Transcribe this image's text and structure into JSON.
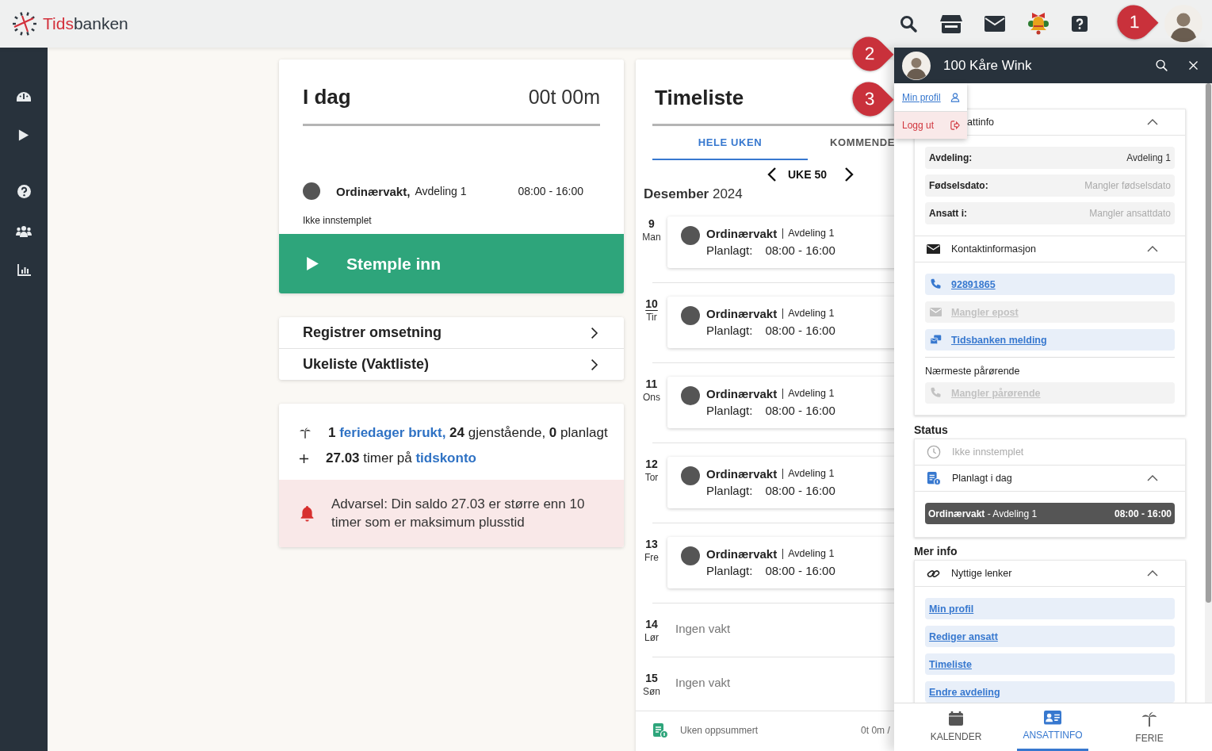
{
  "logo": {
    "accent": "Tids",
    "rest": "banken"
  },
  "callouts": [
    {
      "label": "1"
    },
    {
      "label": "2"
    },
    {
      "label": "3"
    }
  ],
  "today": {
    "title": "I dag",
    "total": "00t 00m",
    "shift": {
      "name": "Ordinærvakt,",
      "department": "Avdeling 1",
      "time": "08:00 - 16:00"
    },
    "status": "Ikke innstemplet",
    "clock_in_button": "Stemple inn"
  },
  "quick_links": [
    {
      "label": "Registrer omsetning"
    },
    {
      "label": "Ukeliste (Vaktliste)"
    }
  ],
  "balance": {
    "vacation": [
      {
        "text": "1",
        "kind": "value"
      },
      {
        "text": "feriedager brukt,",
        "kind": "link"
      },
      {
        "text": "24",
        "kind": "value"
      },
      {
        "text": "gjenstående,",
        "kind": "plain"
      },
      {
        "text": "0",
        "kind": "value"
      },
      {
        "text": "planlagt",
        "kind": "plain"
      }
    ],
    "flex": [
      {
        "text": "27.03",
        "kind": "value"
      },
      {
        "text": "timer på",
        "kind": "plain"
      },
      {
        "text": "tidskonto",
        "kind": "link"
      }
    ],
    "warning": "Advarsel: Din saldo 27.03 er større enn 10 timer som er maksimum plusstid"
  },
  "timesheet": {
    "title": "Timeliste",
    "tabs": [
      {
        "label": "HELE UKEN",
        "selected": true
      },
      {
        "label": "KOMMENDE",
        "selected": false
      }
    ],
    "week": "UKE 50",
    "month": "Desember",
    "year": "2024",
    "days": [
      {
        "date": "9",
        "weekday": "Man",
        "today": false,
        "kind": "shift",
        "name": "Ordinærvakt",
        "department": "Avdeling 1",
        "planned_label": "Planlagt:",
        "time": "08:00 - 16:00"
      },
      {
        "date": "10",
        "weekday": "Tir",
        "today": true,
        "kind": "shift",
        "name": "Ordinærvakt",
        "department": "Avdeling 1",
        "planned_label": "Planlagt:",
        "time": "08:00 - 16:00"
      },
      {
        "date": "11",
        "weekday": "Ons",
        "today": false,
        "kind": "shift",
        "name": "Ordinærvakt",
        "department": "Avdeling 1",
        "planned_label": "Planlagt:",
        "time": "08:00 - 16:00"
      },
      {
        "date": "12",
        "weekday": "Tor",
        "today": false,
        "kind": "shift",
        "name": "Ordinærvakt",
        "department": "Avdeling 1",
        "planned_label": "Planlagt:",
        "time": "08:00 - 16:00"
      },
      {
        "date": "13",
        "weekday": "Fre",
        "today": false,
        "kind": "shift",
        "name": "Ordinærvakt",
        "department": "Avdeling 1",
        "planned_label": "Planlagt:",
        "time": "08:00 - 16:00"
      },
      {
        "date": "14",
        "weekday": "Lør",
        "today": false,
        "kind": "empty",
        "text": "Ingen vakt"
      },
      {
        "date": "15",
        "weekday": "Søn",
        "today": false,
        "kind": "empty",
        "text": "Ingen vakt"
      }
    ],
    "summary": {
      "label": "Uken oppsummert",
      "value": "0t 0m /"
    }
  },
  "panel": {
    "name": "100 Kåre Wink",
    "menu": [
      {
        "label": "Min profil",
        "kind": "profile"
      },
      {
        "label": "Logg ut",
        "kind": "logout"
      }
    ],
    "employee_info": {
      "title": "attinfo",
      "expanded": true,
      "fields": [
        {
          "label": "Avdeling:",
          "value": "Avdeling 1",
          "missing": false
        },
        {
          "label": "Fødselsdato:",
          "value": "Mangler fødselsdato",
          "missing": true
        },
        {
          "label": "Ansatt i:",
          "value": "Mangler ansattdato",
          "missing": true
        }
      ]
    },
    "contact": {
      "title": "Kontaktinformasjon",
      "expanded": true,
      "items": [
        {
          "kind": "phone",
          "text": "92891865",
          "missing": false
        },
        {
          "kind": "mail",
          "text": "Mangler epost",
          "missing": true
        },
        {
          "kind": "message",
          "text": "Tidsbanken melding",
          "missing": false
        }
      ],
      "relative_title": "Nærmeste pårørende",
      "relative": {
        "kind": "phone",
        "text": "Mangler pårørende",
        "missing": true
      }
    },
    "status": {
      "title": "Status",
      "clock": "Ikke innstemplet",
      "planned": {
        "title": "Planlagt i dag",
        "expanded": true,
        "name": "Ordinærvakt",
        "department": "- Avdeling 1",
        "time": "08:00 - 16:00"
      }
    },
    "more_info": {
      "title": "Mer info",
      "links_title": "Nyttige lenker",
      "expanded": true,
      "links": [
        {
          "label": "Min profil"
        },
        {
          "label": "Rediger ansatt"
        },
        {
          "label": "Timeliste"
        },
        {
          "label": "Endre avdeling"
        }
      ]
    },
    "bottom_nav": [
      {
        "label": "KALENDER",
        "kind": "calendar",
        "selected": false
      },
      {
        "label": "ANSATTINFO",
        "kind": "employee",
        "selected": true
      },
      {
        "label": "FERIE",
        "kind": "vacation",
        "selected": false
      }
    ]
  }
}
